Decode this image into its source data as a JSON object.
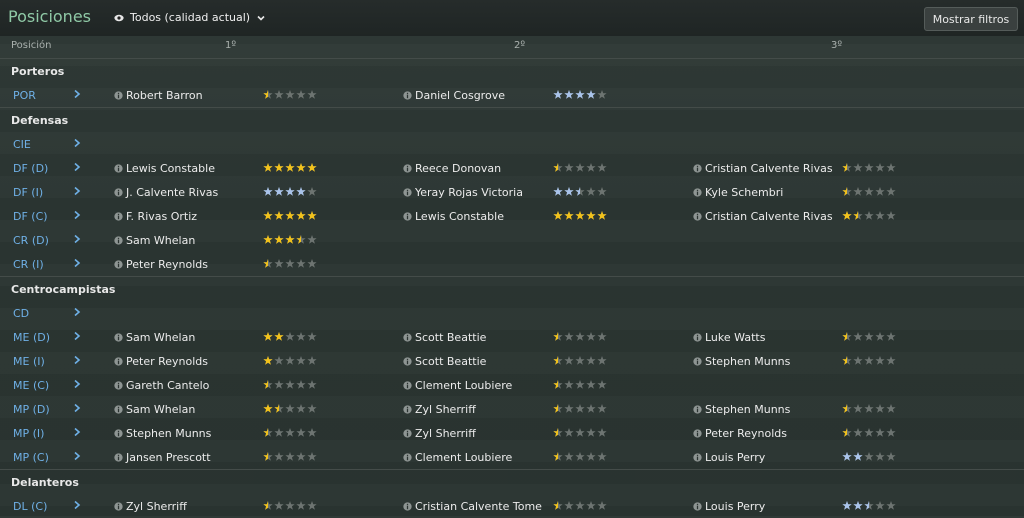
{
  "header": {
    "title": "Posiciones",
    "view_select": "Todos (calidad actual)",
    "filter_button": "Mostrar filtros"
  },
  "columns": {
    "position": "Posición",
    "first": "1º",
    "second": "2º",
    "third": "3º"
  },
  "colors": {
    "star_gold": "#f2c21b",
    "star_silver": "#a9c3ea",
    "star_empty": "#6d7471",
    "position_blue": "#6fb0e6",
    "title_green": "#8fc9a6"
  },
  "rows": [
    {
      "type": "group",
      "label": "Porteros"
    },
    {
      "type": "pos",
      "label": "POR",
      "players": [
        {
          "name": "Robert Barron",
          "rating": 0.5,
          "color": "gold"
        },
        {
          "name": "Daniel Cosgrove",
          "rating": 4,
          "color": "silver"
        }
      ]
    },
    {
      "type": "group",
      "label": "Defensas"
    },
    {
      "type": "pos",
      "label": "CIE",
      "players": []
    },
    {
      "type": "pos",
      "label": "DF (D)",
      "players": [
        {
          "name": "Lewis Constable",
          "rating": 5,
          "color": "gold"
        },
        {
          "name": "Reece Donovan",
          "rating": 0.5,
          "color": "gold"
        },
        {
          "name": "Cristian Calvente Rivas",
          "rating": 0.5,
          "color": "gold"
        }
      ]
    },
    {
      "type": "pos",
      "label": "DF (I)",
      "players": [
        {
          "name": "J. Calvente Rivas",
          "rating": 4,
          "color": "silver"
        },
        {
          "name": "Yeray Rojas Victoria",
          "rating": 2.5,
          "color": "silver"
        },
        {
          "name": "Kyle Schembri",
          "rating": 0.5,
          "color": "gold"
        }
      ]
    },
    {
      "type": "pos",
      "label": "DF (C)",
      "players": [
        {
          "name": "F. Rivas Ortiz",
          "rating": 5,
          "color": "gold"
        },
        {
          "name": "Lewis Constable",
          "rating": 5,
          "color": "gold"
        },
        {
          "name": "Cristian Calvente Rivas",
          "rating": 1.5,
          "color": "gold"
        }
      ]
    },
    {
      "type": "pos",
      "label": "CR (D)",
      "players": [
        {
          "name": "Sam Whelan",
          "rating": 3.5,
          "color": "gold"
        }
      ]
    },
    {
      "type": "pos",
      "label": "CR (I)",
      "players": [
        {
          "name": "Peter Reynolds",
          "rating": 0.5,
          "color": "gold"
        }
      ]
    },
    {
      "type": "group",
      "label": "Centrocampistas"
    },
    {
      "type": "pos",
      "label": "CD",
      "players": []
    },
    {
      "type": "pos",
      "label": "ME (D)",
      "players": [
        {
          "name": "Sam Whelan",
          "rating": 2,
          "color": "gold"
        },
        {
          "name": "Scott Beattie",
          "rating": 0.5,
          "color": "gold"
        },
        {
          "name": "Luke Watts",
          "rating": 0.5,
          "color": "gold"
        }
      ]
    },
    {
      "type": "pos",
      "label": "ME (I)",
      "players": [
        {
          "name": "Peter Reynolds",
          "rating": 1,
          "color": "gold"
        },
        {
          "name": "Scott Beattie",
          "rating": 0.5,
          "color": "gold"
        },
        {
          "name": "Stephen Munns",
          "rating": 0.5,
          "color": "gold"
        }
      ]
    },
    {
      "type": "pos",
      "label": "ME (C)",
      "players": [
        {
          "name": "Gareth Cantelo",
          "rating": 0.5,
          "color": "gold"
        },
        {
          "name": "Clement Loubiere",
          "rating": 0.5,
          "color": "gold"
        }
      ]
    },
    {
      "type": "pos",
      "label": "MP (D)",
      "players": [
        {
          "name": "Sam Whelan",
          "rating": 1.5,
          "color": "gold"
        },
        {
          "name": "Zyl Sherriff",
          "rating": 0.5,
          "color": "gold"
        },
        {
          "name": "Stephen Munns",
          "rating": 0.5,
          "color": "gold"
        }
      ]
    },
    {
      "type": "pos",
      "label": "MP (I)",
      "players": [
        {
          "name": "Stephen Munns",
          "rating": 0.5,
          "color": "gold"
        },
        {
          "name": "Zyl Sherriff",
          "rating": 0.5,
          "color": "gold"
        },
        {
          "name": "Peter Reynolds",
          "rating": 0.5,
          "color": "gold"
        }
      ]
    },
    {
      "type": "pos",
      "label": "MP (C)",
      "players": [
        {
          "name": "Jansen Prescott",
          "rating": 0.5,
          "color": "gold"
        },
        {
          "name": "Clement Loubiere",
          "rating": 0.5,
          "color": "gold"
        },
        {
          "name": "Louis Perry",
          "rating": 2,
          "color": "silver"
        }
      ]
    },
    {
      "type": "group",
      "label": "Delanteros"
    },
    {
      "type": "pos",
      "label": "DL (C)",
      "players": [
        {
          "name": "Zyl Sherriff",
          "rating": 0.5,
          "color": "gold"
        },
        {
          "name": "Cristian Calvente Tome",
          "rating": 0.5,
          "color": "gold"
        },
        {
          "name": "Louis Perry",
          "rating": 2.5,
          "color": "silver"
        }
      ]
    }
  ]
}
